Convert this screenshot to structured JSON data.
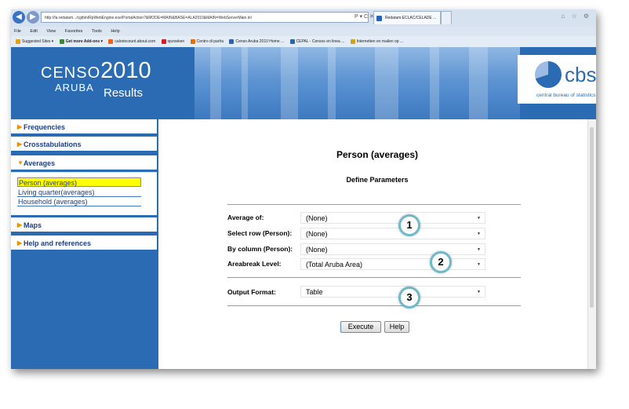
{
  "browser": {
    "url": "http://la.redatam.../cgibin/RpWebEngine.exe/PortalAction?&MODE=MAIN&BASE=ALA2010&MAIN=WebServerMain.inl",
    "address_tools": "P ▾ C ✕",
    "active_tab": "Redatam ECLAC/CELADE ...",
    "new_tab": "",
    "window_controls": "⌂ ☆ ⚙",
    "menu": [
      "File",
      "Edit",
      "View",
      "Favorites",
      "Tools",
      "Help"
    ],
    "favorites": [
      "Suggested Sites ▾",
      "Get more Add-ons ▾",
      "caloriecount.about.com",
      "opzoeken",
      "Centro di parha",
      "Censo Aruba 2010 Home ...",
      "CEPAL - Censos en linea ...",
      "Internetten en mailen op ..."
    ],
    "colors": {
      "fav_icons": [
        "#e8a010",
        "#3a8a2a",
        "#f06020",
        "#d02020",
        "#e07010",
        "#2a63b5",
        "#2a63b5",
        "#d0a020"
      ]
    }
  },
  "header": {
    "logo_censo": "CENSO",
    "logo_year": "2010",
    "logo_aruba": "ARUBA",
    "logo_results": "Results",
    "cbs_logo": "cbs",
    "cbs_subtitle": "central bureau of statistics"
  },
  "sidebar": {
    "items": [
      {
        "label": "Frequencies"
      },
      {
        "label": "Crosstabulations"
      },
      {
        "label": "Averages",
        "expanded": true
      },
      {
        "label": "Maps"
      },
      {
        "label": "Help and references"
      }
    ],
    "averages_sub": [
      "Person (averages)",
      "Living quarter(averages)",
      "Household (averages)"
    ],
    "selected_sub": "Person (averages)"
  },
  "main": {
    "title": "Person (averages)",
    "subtitle": "Define Parameters",
    "params": [
      {
        "label": "Average of:",
        "value": "(None)"
      },
      {
        "label": "Select row (Person):",
        "value": "(None)"
      },
      {
        "label": "By column (Person):",
        "value": "(None)"
      },
      {
        "label": "Areabreak Level:",
        "value": "(Total Aruba Area)"
      }
    ],
    "output": {
      "label": "Output Format:",
      "value": "Table"
    },
    "badges": [
      "1",
      "2",
      "3"
    ],
    "execute_label": "Execute",
    "help_label": "Help"
  },
  "colors": {
    "brand_blue": "#2a6bb3",
    "nav_arrow": "#f29100",
    "highlight": "#ffff00",
    "badge_ring": "#6fb9c9"
  }
}
